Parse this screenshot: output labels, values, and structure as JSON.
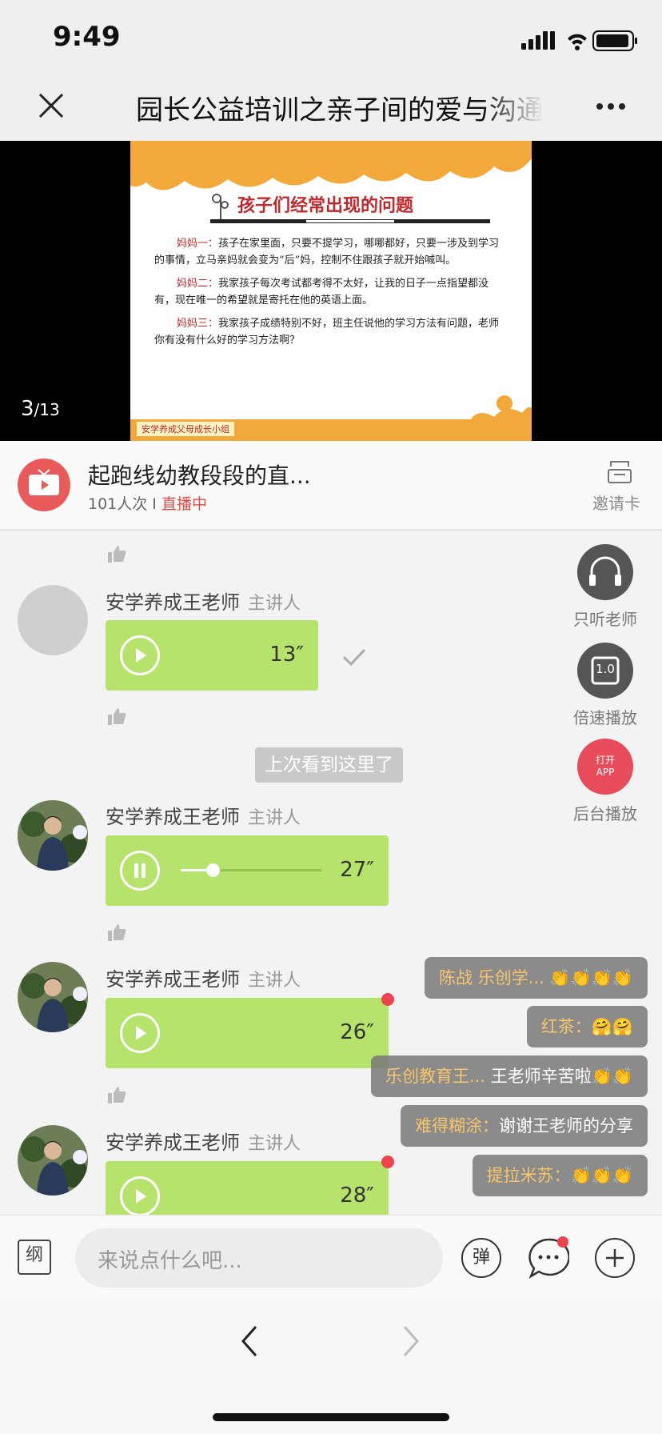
{
  "status_bar": {
    "time": "9:49"
  },
  "nav": {
    "title": "园长公益培训之亲子间的爱与沟通"
  },
  "player": {
    "slide": {
      "title": "孩子们经常出现的问题",
      "paragraphs": [
        {
          "speaker": "妈妈一：",
          "text": "孩子在家里面，只要不提学习，哪哪都好，只要一涉及到学习的事情，立马亲妈就会变为“后”妈，控制不住跟孩子就开始喊叫。"
        },
        {
          "speaker": "妈妈二：",
          "text": "我家孩子每次考试都考得不太好，让我的日子一点指望都没有，现在唯一的希望就是寄托在他的英语上面。"
        },
        {
          "speaker": "妈妈三：",
          "text": "我家孩子成绩特别不好，班主任说他的学习方法有问题，老师你有没有什么好的学习方法啊？"
        }
      ],
      "footer": "安学养成父母成长小组"
    },
    "page_current": "3",
    "page_total": "/13"
  },
  "live": {
    "title": "起跑线幼教段段的直...",
    "viewers": "101人次 I ",
    "status": "直播中",
    "invite_label": "邀请卡"
  },
  "side": {
    "listen_teacher": "只听老师",
    "speed_icon_text": "1.0",
    "speed_label": "倍速播放",
    "open_app": "打开APP",
    "background_play": "后台播放"
  },
  "messages": [
    {
      "name": "安学养成王老师",
      "role": "主讲人",
      "duration": "13″"
    },
    {
      "name": "安学养成王老师",
      "role": "主讲人",
      "duration": "27″",
      "progress": 0.23
    },
    {
      "name": "安学养成王老师",
      "role": "主讲人",
      "duration": "26″"
    },
    {
      "name": "安学养成王老师",
      "role": "主讲人",
      "duration": "28″"
    }
  ],
  "last_seen": "上次看到这里了",
  "danmu": [
    {
      "user": "陈战 乐创学...",
      "text": " 👏👏👏👏"
    },
    {
      "user": "红茶：",
      "text": "🤗🤗"
    },
    {
      "user": "乐创教育王...",
      "text": "  王老师辛苦啦👏👏"
    },
    {
      "user": "难得糊涂：",
      "text": "谢谢王老师的分享"
    },
    {
      "user": "提拉米苏：",
      "text": "👏👏👏"
    }
  ],
  "input": {
    "outline_label": "纲",
    "placeholder": "来说点什么吧...",
    "danmu_label": "弹"
  }
}
